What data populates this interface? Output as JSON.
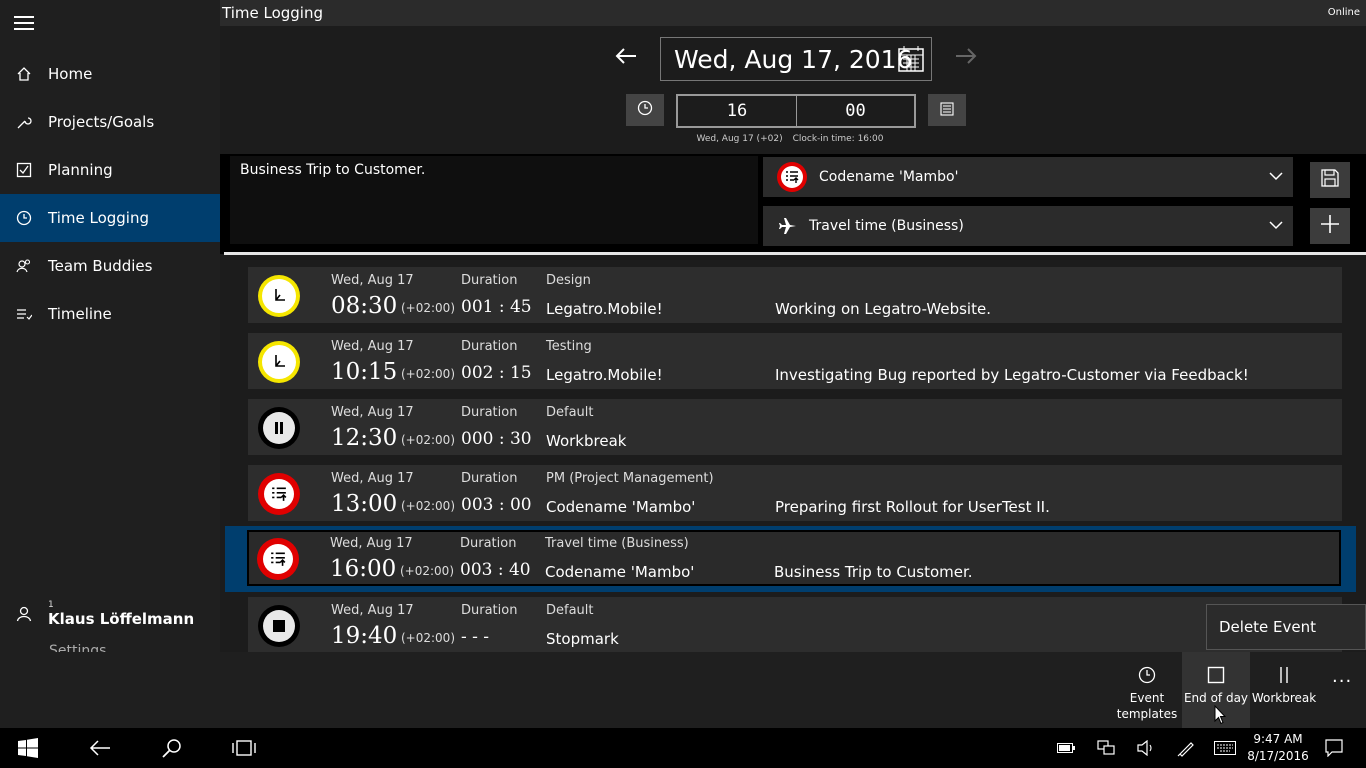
{
  "window": {
    "title": "Time Logging",
    "status": "Online"
  },
  "sidebar": {
    "items": [
      {
        "label": "Home",
        "icon": "home-icon"
      },
      {
        "label": "Projects/Goals",
        "icon": "wrench-icon"
      },
      {
        "label": "Planning",
        "icon": "checkbox-icon"
      },
      {
        "label": "Time Logging",
        "icon": "clock-icon",
        "active": true
      },
      {
        "label": "Team Buddies",
        "icon": "people-icon"
      },
      {
        "label": "Timeline",
        "icon": "timeline-icon"
      }
    ],
    "user": {
      "badge": "1",
      "name": "Klaus Löffelmann"
    },
    "settings_label": "Settings"
  },
  "header": {
    "date": "Wed, Aug 17, 2016",
    "time_hours": "16",
    "time_minutes": "00",
    "clockin_date": "Wed, Aug 17 (+02)",
    "clockin_label": "Clock-in time: 16:00"
  },
  "editor": {
    "description": "Business Trip to Customer.",
    "project": "Codename 'Mambo'",
    "category": "Travel time (Business)"
  },
  "events": [
    {
      "date": "Wed, Aug 17",
      "time": "08:30",
      "offset": "(+02:00)",
      "duration_label": "Duration",
      "duration": "001 : 45",
      "category": "Design",
      "project": "Legatro.Mobile!",
      "note": "Working on Legatro-Website.",
      "icon": "work-icon"
    },
    {
      "date": "Wed, Aug 17",
      "time": "10:15",
      "offset": "(+02:00)",
      "duration_label": "Duration",
      "duration": "002 : 15",
      "category": "Testing",
      "project": "Legatro.Mobile!",
      "note": "Investigating Bug reported by Legatro-Customer via Feedback!",
      "icon": "work-icon"
    },
    {
      "date": "Wed, Aug 17",
      "time": "12:30",
      "offset": "(+02:00)",
      "duration_label": "Duration",
      "duration": "000 : 30",
      "category": "Default",
      "project": "Workbreak",
      "note": "",
      "icon": "pause-icon"
    },
    {
      "date": "Wed, Aug 17",
      "time": "13:00",
      "offset": "(+02:00)",
      "duration_label": "Duration",
      "duration": "003 : 00",
      "category": "PM (Project Management)",
      "project": "Codename 'Mambo'",
      "note": "Preparing first Rollout for UserTest II.",
      "icon": "project-icon"
    },
    {
      "date": "Wed, Aug 17",
      "time": "16:00",
      "offset": "(+02:00)",
      "duration_label": "Duration",
      "duration": "003 : 40",
      "category": "Travel time (Business)",
      "project": "Codename 'Mambo'",
      "note": "Business Trip to Customer.",
      "icon": "project-icon",
      "selected": true
    },
    {
      "date": "Wed, Aug 17",
      "time": "19:40",
      "offset": "(+02:00)",
      "duration_label": "Duration",
      "duration": "- - -",
      "category": "Default",
      "project": "Stopmark",
      "note": "",
      "icon": "stop-icon"
    }
  ],
  "context_menu": {
    "delete_label": "Delete Event"
  },
  "commandbar": {
    "event_templates_l1": "Event",
    "event_templates_l2": "templates",
    "end_of_day": "End of day",
    "workbreak": "Workbreak",
    "more": "..."
  },
  "taskbar": {
    "time": "9:47 AM",
    "date": "8/17/2016"
  },
  "colors": {
    "accent": "#003e6e",
    "sidebar_bg": "#1f1f1f",
    "row_bg": "#2d2d2d",
    "work_icon": "#f5e600",
    "project_icon": "#e00000"
  }
}
